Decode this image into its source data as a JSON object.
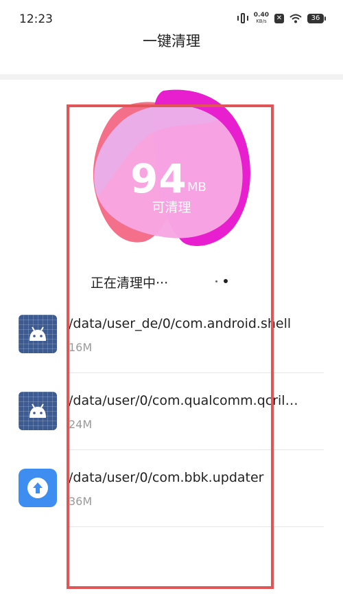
{
  "status_bar": {
    "time": "12:23",
    "net_speed_value": "0.40",
    "net_speed_unit": "KB/s",
    "battery_level": "36"
  },
  "header": {
    "title": "一键清理"
  },
  "cleanable": {
    "size_value": "94",
    "size_unit": "MB",
    "caption": "可清理"
  },
  "cleaning_status": "正在清理中···",
  "items": [
    {
      "path": "/data/user_de/0/com.android.shell",
      "size": "16M",
      "icon": "android-icon"
    },
    {
      "path": "/data/user/0/com.qualcomm.qcril…",
      "size": "24M",
      "icon": "android-icon"
    },
    {
      "path": "/data/user/0/com.bbk.updater",
      "size": "36M",
      "icon": "updater-icon"
    }
  ],
  "colors": {
    "highlight_border": "#e05555",
    "blob_pink": "#f7a6e2",
    "blob_magenta": "#e81fcf",
    "blob_coral": "#f36f8a",
    "updater_blue": "#3d8ef0",
    "android_navy": "#3d5a91"
  }
}
